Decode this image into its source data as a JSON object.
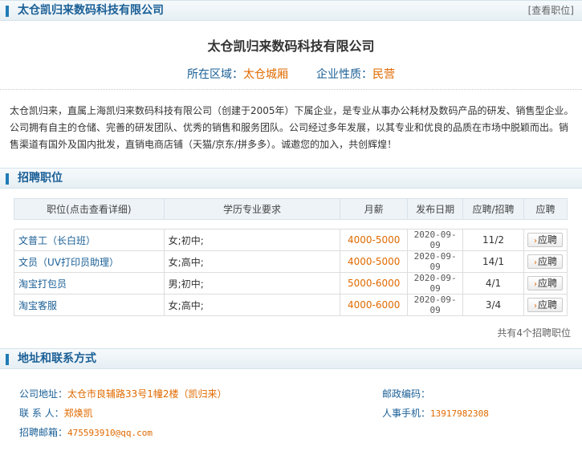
{
  "header": {
    "company": "太仓凯归来数码科技有限公司",
    "view_jobs_link": "[查看职位]"
  },
  "company": {
    "name": "太仓凯归来数码科技有限公司",
    "region_label": "所在区域：",
    "region_value": "太仓城厢",
    "nature_label": "企业性质：",
    "nature_value": "民营",
    "intro": "太仓凯归来，直属上海凯归来数码科技有限公司（创建于2005年）下属企业，是专业从事办公耗材及数码产品的研发、销售型企业。公司拥有自主的仓储、完善的研发团队、优秀的销售和服务团队。公司经过多年发展，以其专业和优良的品质在市场中脱颖而出。销售渠道有国外及国内批发，直销电商店铺（天猫/京东/拼多多）。诚邀您的加入，共创辉煌！"
  },
  "jobs_section": {
    "title": "招聘职位",
    "columns": [
      "职位(点击查看详细)",
      "学历专业要求",
      "月薪",
      "发布日期",
      "应聘/招聘",
      "应聘"
    ],
    "rows": [
      {
        "title": "文普工（长白班）",
        "req": "女;初中;",
        "salary": "4000-5000",
        "date": "2020-09-09",
        "ratio": "11/2",
        "apply": "应聘"
      },
      {
        "title": "文员（UV打印员助理）",
        "req": "女;高中;",
        "salary": "4000-5000",
        "date": "2020-09-09",
        "ratio": "14/1",
        "apply": "应聘"
      },
      {
        "title": "淘宝打包员",
        "req": "男;初中;",
        "salary": "5000-6000",
        "date": "2020-09-09",
        "ratio": "4/1",
        "apply": "应聘"
      },
      {
        "title": "淘宝客服",
        "req": "女;高中;",
        "salary": "4000-6000",
        "date": "2020-09-09",
        "ratio": "3/4",
        "apply": "应聘"
      }
    ],
    "total": "共有4个招聘职位"
  },
  "contact_section": {
    "title": "地址和联系方式",
    "address_label": "公司地址：",
    "address_value": "太仓市良辅路33号1幢2楼（凯归来）",
    "postcode_label": "邮政编码：",
    "postcode_value": "",
    "contact_label": "联 系 人：",
    "contact_value": "郑焕凯",
    "mobile_label": "人事手机：",
    "mobile_value": "13917982308",
    "email_label": "招聘邮箱：",
    "email_value": "475593910@qq.com"
  }
}
